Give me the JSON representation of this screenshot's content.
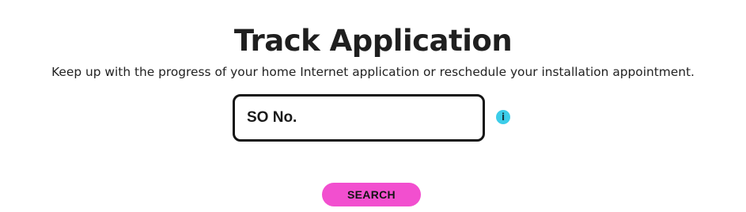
{
  "header": {
    "title": "Track Application",
    "subtitle": "Keep up with the progress of your home Internet application or reschedule your installation appointment."
  },
  "form": {
    "so_input": {
      "value": "",
      "placeholder": "SO No."
    },
    "info_icon": {
      "glyph": "i",
      "name": "info-icon"
    },
    "search_label": "SEARCH"
  },
  "colors": {
    "button_bg": "#f24fcf",
    "info_icon_bg": "#3ccde9",
    "field_border": "#151515",
    "text": "#1f1f1f"
  }
}
